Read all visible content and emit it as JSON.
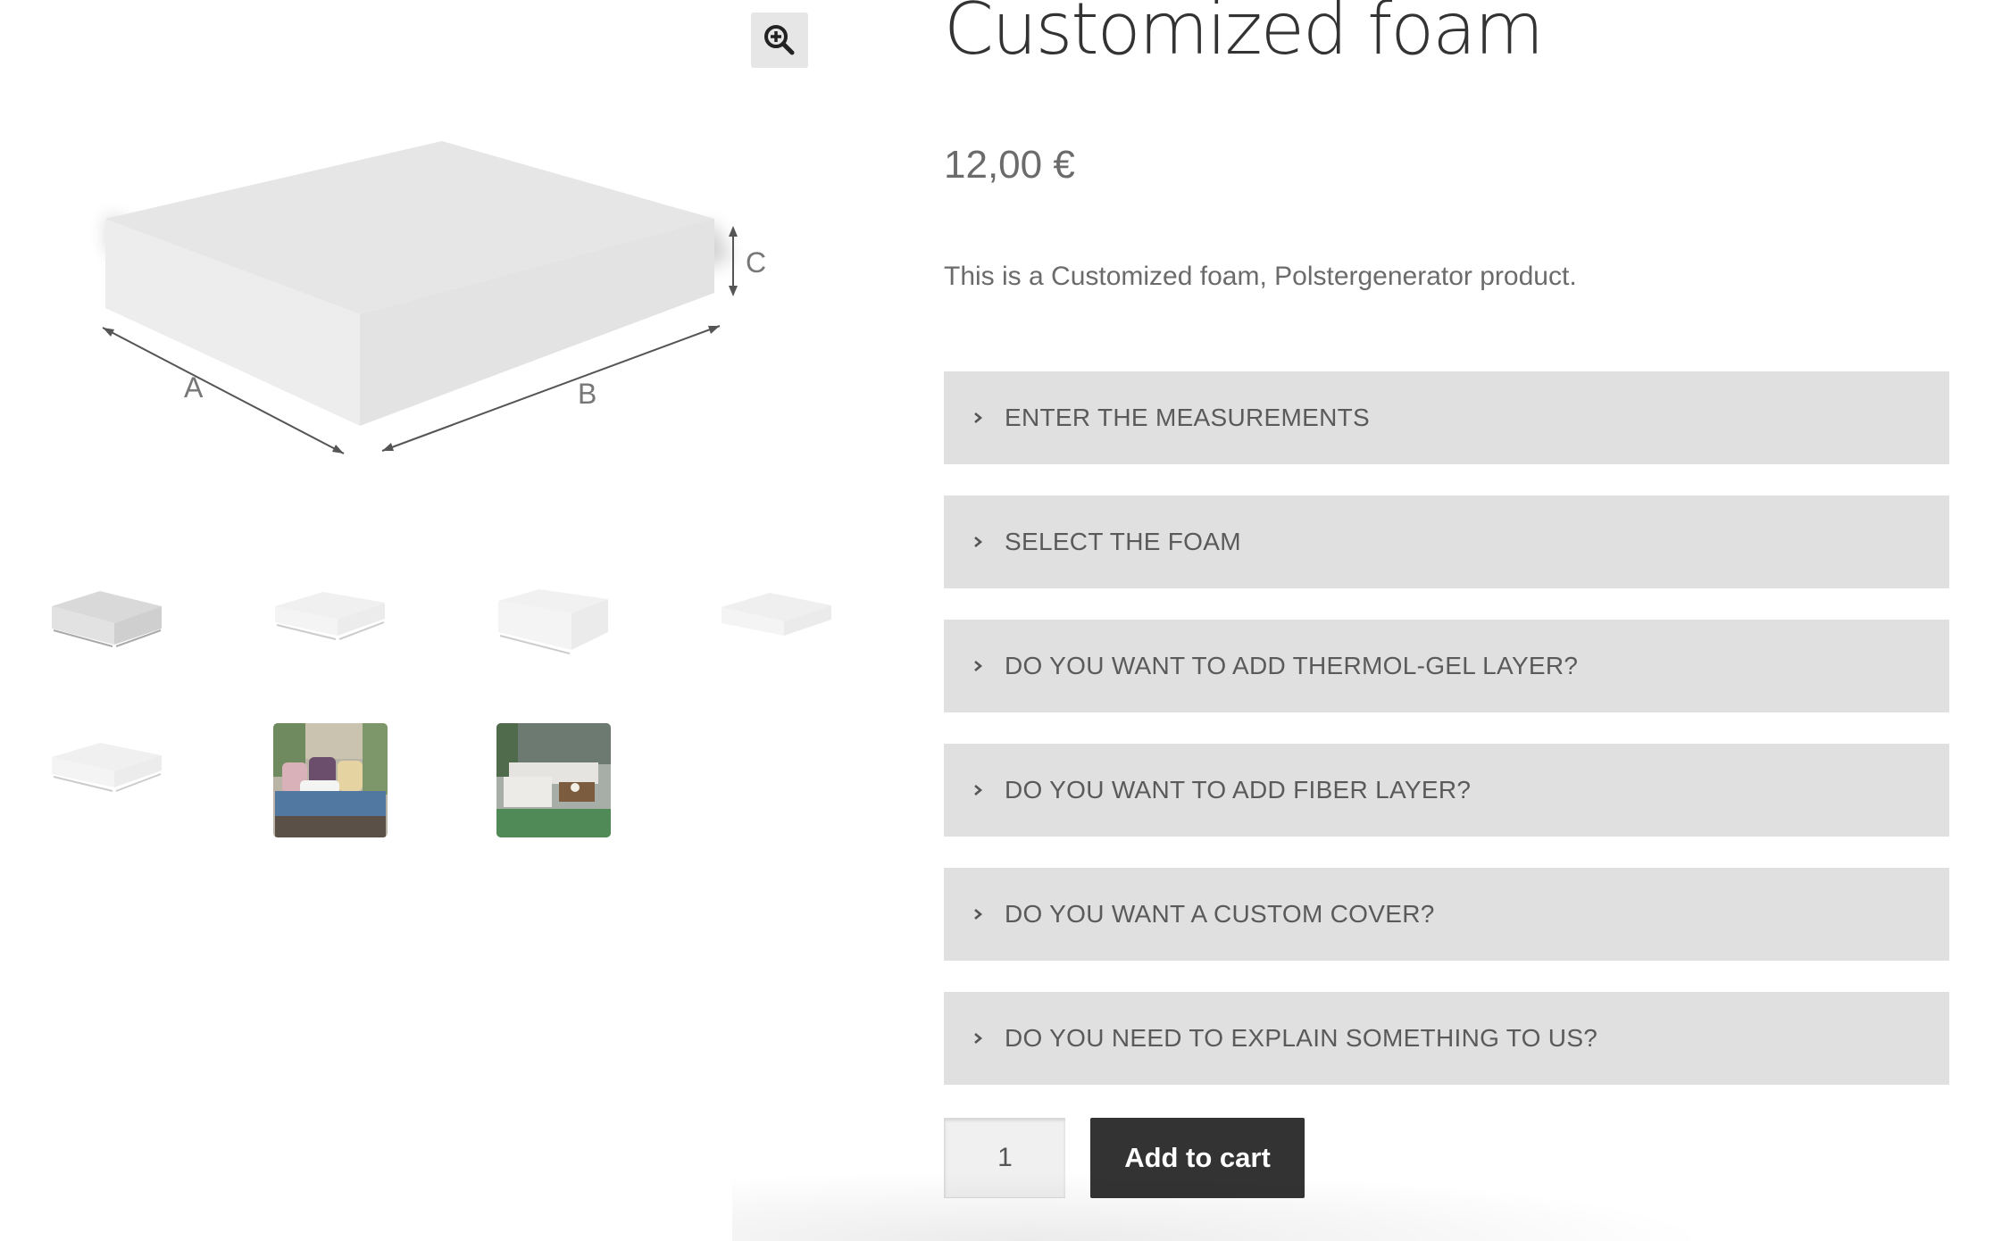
{
  "gallery": {
    "zoom_icon": "zoom-in-icon",
    "dimension_labels": {
      "a": "A",
      "b": "B",
      "c": "C"
    },
    "thumbnails": [
      {
        "kind": "foam-block-grey"
      },
      {
        "kind": "foam-block-light"
      },
      {
        "kind": "foam-block-tall"
      },
      {
        "kind": "foam-block-flat"
      },
      {
        "kind": "foam-block-light"
      },
      {
        "kind": "photo-sofa-cushion"
      },
      {
        "kind": "photo-outdoor-lounge"
      }
    ]
  },
  "product": {
    "title": "Customized foam",
    "price": "12,00 €",
    "description": "This is a Customized foam, Polstergenerator product."
  },
  "accordions": [
    {
      "label": "ENTER THE MEASUREMENTS"
    },
    {
      "label": "SELECT THE FOAM"
    },
    {
      "label": "DO YOU WANT TO ADD THERMOL-GEL LAYER?"
    },
    {
      "label": "DO YOU WANT TO ADD FIBER LAYER?"
    },
    {
      "label": "DO YOU WANT A CUSTOM COVER?"
    },
    {
      "label": "DO YOU NEED TO EXPLAIN SOMETHING TO US?"
    }
  ],
  "cart": {
    "quantity": "1",
    "add_to_cart_label": "Add to cart"
  },
  "colors": {
    "accordion_bg": "#e0e0e0",
    "button_bg": "#333333",
    "text": "#555555"
  }
}
